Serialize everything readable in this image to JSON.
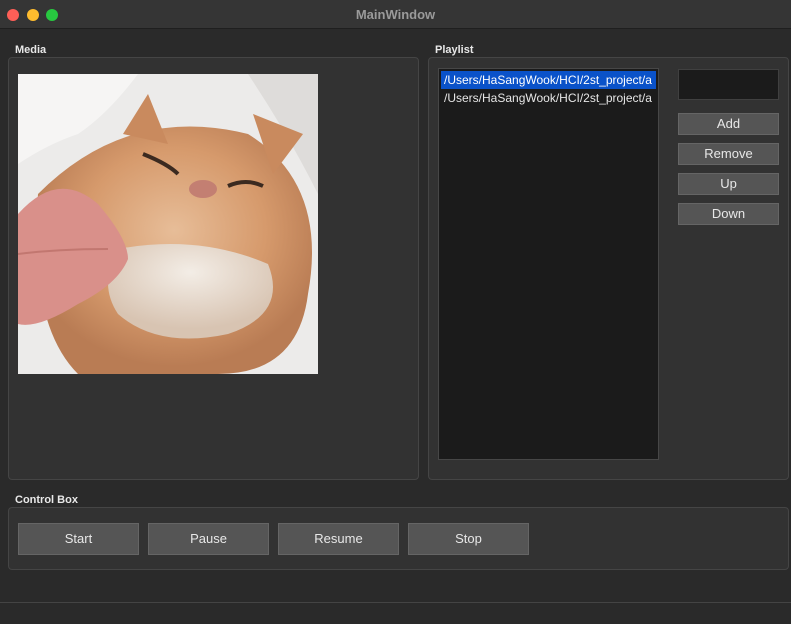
{
  "window": {
    "title": "MainWindow"
  },
  "media": {
    "group_label": "Media"
  },
  "playlist": {
    "group_label": "Playlist",
    "items": [
      {
        "text": "/Users/HaSangWook/HCI/2st_project/a",
        "selected": true
      },
      {
        "text": "/Users/HaSangWook/HCI/2st_project/a",
        "selected": false
      }
    ],
    "name_field_value": "",
    "buttons": {
      "add": "Add",
      "remove": "Remove",
      "up": "Up",
      "down": "Down"
    }
  },
  "control_box": {
    "group_label": "Control Box",
    "buttons": {
      "start": "Start",
      "pause": "Pause",
      "resume": "Resume",
      "stop": "Stop"
    }
  },
  "colors": {
    "selection": "#0a52c9",
    "close": "#fe5f57",
    "minimize": "#febc2e",
    "maximize": "#28c840"
  }
}
